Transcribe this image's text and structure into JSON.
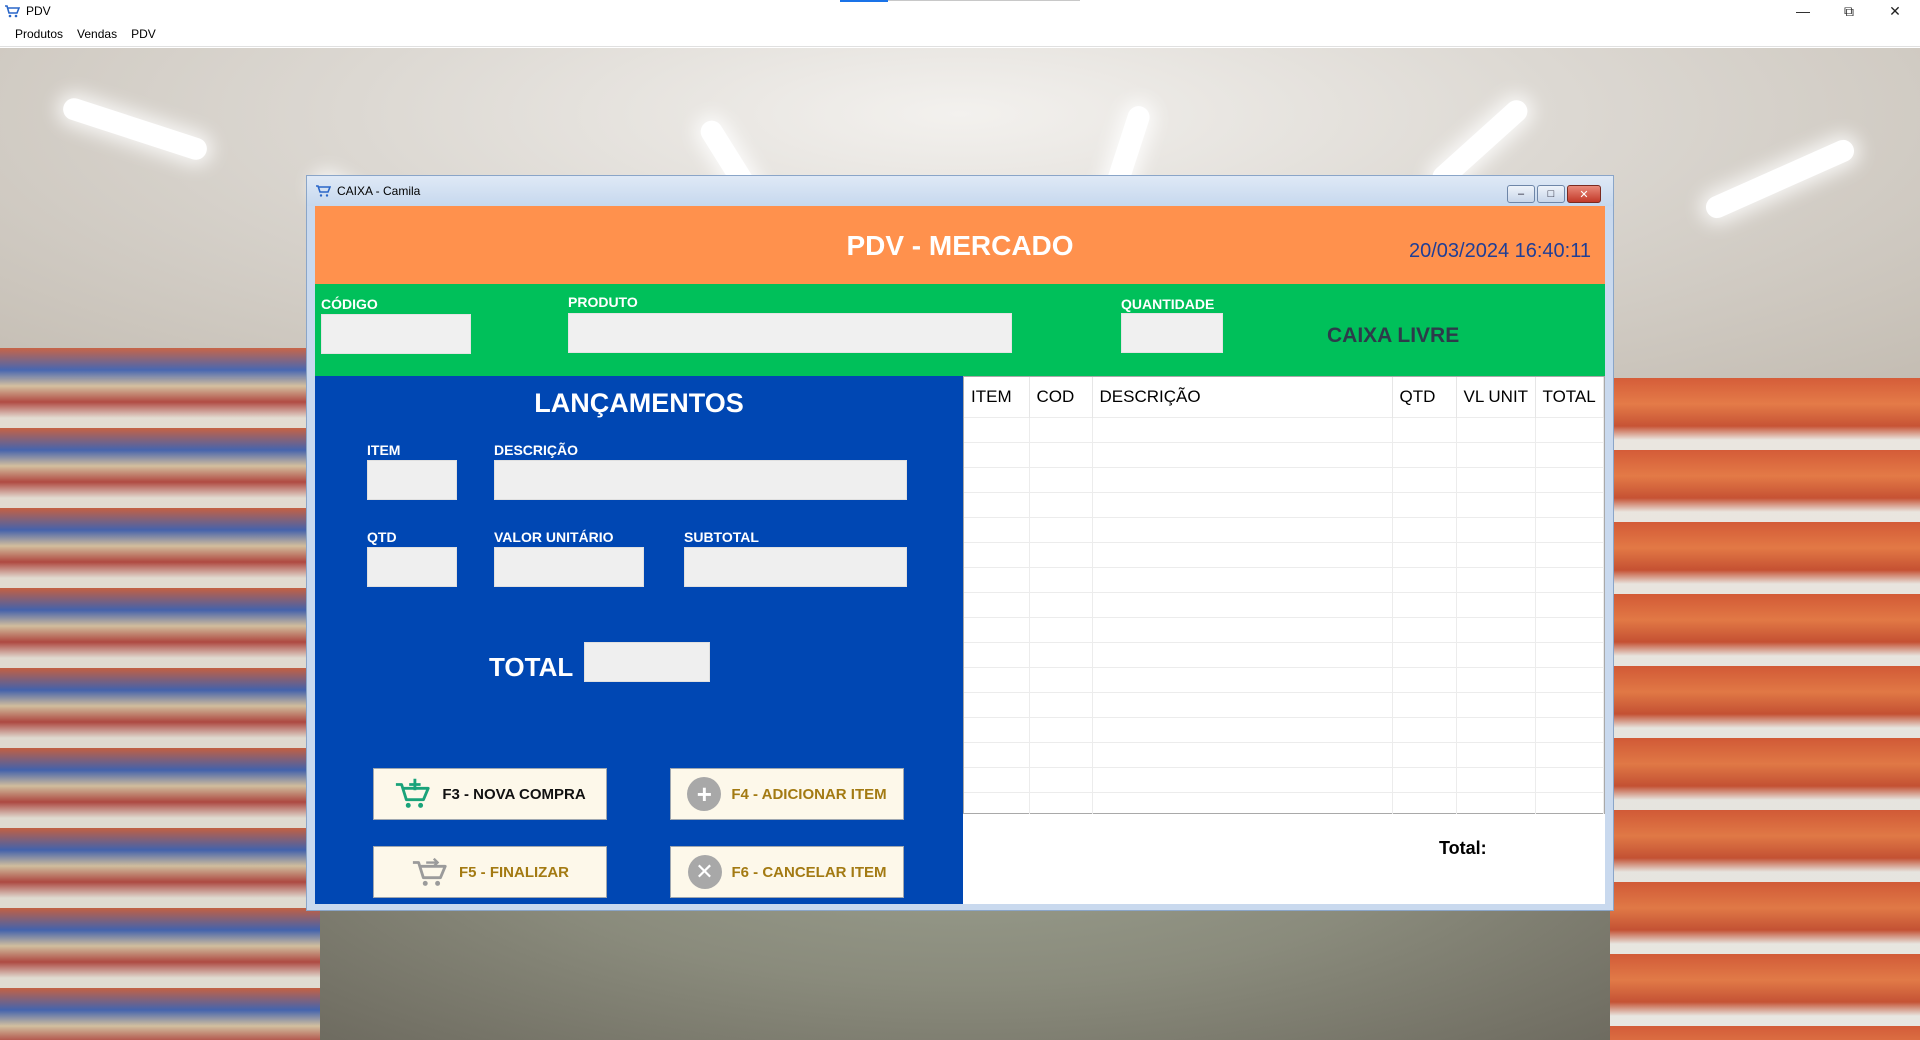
{
  "app": {
    "title": "PDV"
  },
  "menu": [
    "Produtos",
    "Vendas",
    "PDV"
  ],
  "window": {
    "title": "CAIXA - Camila"
  },
  "header": {
    "title": "PDV - MERCADO",
    "datetime": "20/03/2024 16:40:11"
  },
  "search": {
    "codigo_label": "CÓDIGO",
    "produto_label": "PRODUTO",
    "quantidade_label": "QUANTIDADE",
    "codigo_value": "",
    "produto_value": "",
    "quantidade_value": "",
    "status": "CAIXA LIVRE"
  },
  "lancamentos": {
    "title": "LANÇAMENTOS",
    "item_label": "ITEM",
    "descricao_label": "DESCRIÇÃO",
    "qtd_label": "QTD",
    "valor_unitario_label": "VALOR UNITÁRIO",
    "subtotal_label": "SUBTOTAL",
    "total_label": "TOTAL",
    "item_value": "",
    "descricao_value": "",
    "qtd_value": "",
    "valor_unitario_value": "",
    "subtotal_value": "",
    "total_value": ""
  },
  "buttons": {
    "nova_compra": "F3 - NOVA COMPRA",
    "adicionar_item": "F4 - ADICIONAR ITEM",
    "finalizar": "F5 - FINALIZAR",
    "cancelar_item": "F6 - CANCELAR ITEM"
  },
  "grid": {
    "columns": [
      "ITEM",
      "COD",
      "DESCRIÇÃO",
      "QTD",
      "VL UNIT",
      "TOTAL"
    ],
    "rows": []
  },
  "summary": {
    "total_label": "Total:",
    "total_value": ""
  },
  "colors": {
    "header_orange": "#ff914d",
    "search_green": "#00c05a",
    "panel_blue": "#0047b3",
    "datetime_blue": "#1f3e96",
    "button_gold": "#a37a12"
  }
}
